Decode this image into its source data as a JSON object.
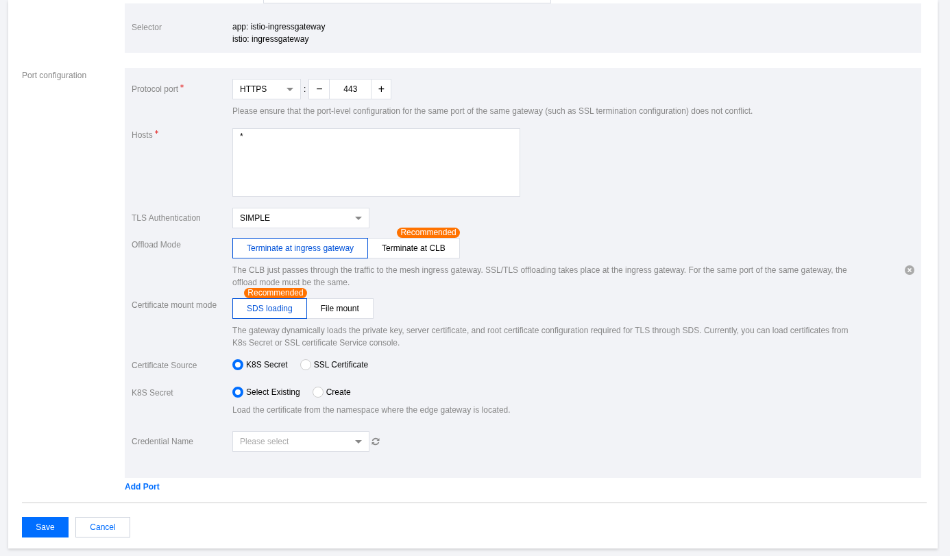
{
  "selector": {
    "label": "Selector",
    "values": [
      "app: istio-ingressgateway",
      "istio: ingressgateway"
    ]
  },
  "port_config": {
    "label": "Port configuration",
    "fields": [
      {
        "kind": "port",
        "label": "Protocol port",
        "required": true,
        "protocol": "HTTPS",
        "separator": ":",
        "minus": "−",
        "port": "443",
        "plus": "+",
        "hint": "Please ensure that the port-level configuration for the same port of the same gateway (such as SSL termination configuration) does not conflict."
      },
      {
        "kind": "textarea",
        "label": "Hosts",
        "required": true,
        "value": "*"
      },
      {
        "kind": "select",
        "label": "TLS Authentication",
        "required": false,
        "value": "SIMPLE"
      },
      {
        "kind": "segmented",
        "label": "Offload Mode",
        "required": false,
        "options": [
          {
            "label": "Terminate at ingress gateway",
            "selected": true
          },
          {
            "label": "Terminate at CLB",
            "selected": false,
            "badge": "Recommended"
          }
        ],
        "hint": "The CLB just passes through the traffic to the mesh ingress gateway. SSL/TLS offloading takes place at the ingress gateway. For the same port of the same gateway, the offload mode must be the same.",
        "closable": true
      },
      {
        "kind": "segmented",
        "label": "Certificate mount mode",
        "required": false,
        "options": [
          {
            "label": "SDS loading",
            "selected": true,
            "badge": "Recommended"
          },
          {
            "label": "File mount",
            "selected": false
          }
        ],
        "hint": "The gateway dynamically loads the private key, server certificate, and root certificate configuration required for TLS through SDS. Currently, you can load certificates from K8s Secret or SSL certificate Service console."
      },
      {
        "kind": "radio",
        "label": "Certificate Source",
        "required": false,
        "options": [
          {
            "label": "K8S Secret",
            "selected": true
          },
          {
            "label": "SSL Certificate",
            "selected": false
          }
        ]
      },
      {
        "kind": "radio",
        "label": "K8S Secret",
        "required": false,
        "options": [
          {
            "label": "Select Existing",
            "selected": true
          },
          {
            "label": "Create",
            "selected": false
          }
        ],
        "hint": "Load the certificate from the namespace where the edge gateway is located."
      },
      {
        "kind": "select",
        "label": "Credential Name",
        "required": false,
        "placeholder": "Please select",
        "refresh": true
      }
    ]
  },
  "add_port": "Add Port",
  "buttons": [
    {
      "label": "Save",
      "primary": true
    },
    {
      "label": "Cancel",
      "primary": false
    }
  ]
}
